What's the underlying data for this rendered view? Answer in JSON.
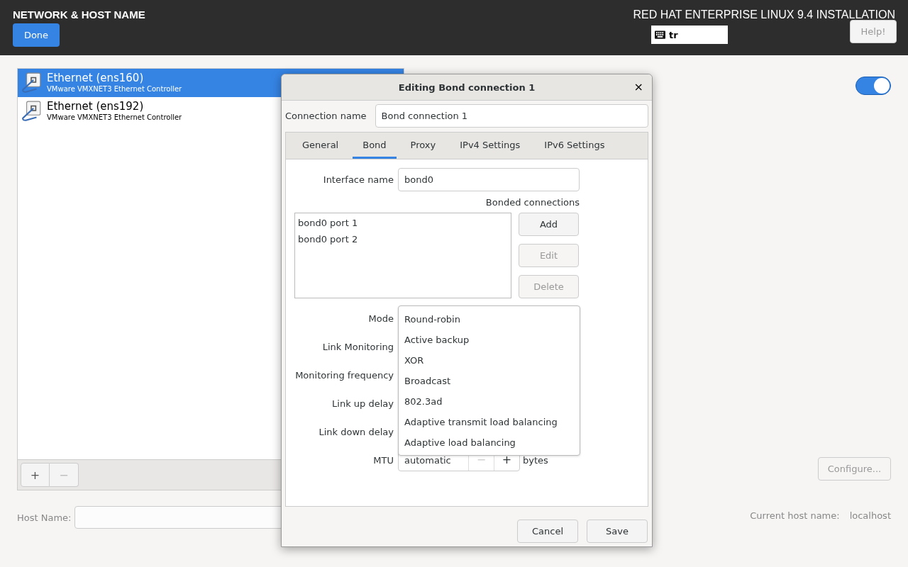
{
  "header": {
    "title": "NETWORK & HOST NAME",
    "done_button": "Done",
    "product": "RED HAT ENTERPRISE LINUX 9.4 INSTALLATION",
    "keyboard_layout": "tr",
    "help_button": {
      "label": "Help!",
      "disabled": true
    }
  },
  "devices": [
    {
      "name": "Ethernet (ens160)",
      "description": "VMware VMXNET3 Ethernet Controller",
      "selected": true
    },
    {
      "name": "Ethernet (ens192)",
      "description": "VMware VMXNET3 Ethernet Controller",
      "selected": false
    }
  ],
  "device_toolbar": [
    {
      "label": "+",
      "disabled": false
    },
    {
      "label": "−",
      "disabled": true
    }
  ],
  "connection_switch": {
    "on": true
  },
  "configure_button": {
    "label": "Configure...",
    "disabled": true
  },
  "host_name": {
    "label": "Host Name:"
  },
  "current_host_name": {
    "label": "Current host name:",
    "value": "localhost"
  },
  "dialog": {
    "title": "Editing Bond connection 1",
    "close": "×",
    "connection_name": {
      "label": "Connection name",
      "value": "Bond connection 1"
    },
    "tabs": [
      {
        "label": "General",
        "selected": false
      },
      {
        "label": "Bond",
        "selected": true
      },
      {
        "label": "Proxy",
        "selected": false
      },
      {
        "label": "IPv4 Settings",
        "selected": false
      },
      {
        "label": "IPv6 Settings",
        "selected": false
      }
    ],
    "interface_name": {
      "label": "Interface name",
      "value": "bond0"
    },
    "bonded_connections": {
      "label": "Bonded connections",
      "items": [
        "bond0 port 1",
        "bond0 port 2"
      ],
      "buttons": [
        {
          "label": "Add",
          "disabled": false
        },
        {
          "label": "Edit",
          "disabled": true
        },
        {
          "label": "Delete",
          "disabled": true
        }
      ]
    },
    "form_labels": [
      "Mode",
      "Link Monitoring",
      "Monitoring frequency",
      "Link up delay",
      "Link down delay",
      "MTU"
    ],
    "mode_options": [
      "Round-robin",
      "Active backup",
      "XOR",
      "Broadcast",
      "802.3ad",
      "Adaptive transmit load balancing",
      "Adaptive load balancing"
    ],
    "mtu": {
      "value": "automatic",
      "decrement": {
        "label": "−",
        "disabled": true
      },
      "increment": {
        "label": "+",
        "disabled": false
      },
      "unit": "bytes"
    },
    "buttons": [
      "Cancel",
      "Save"
    ]
  }
}
